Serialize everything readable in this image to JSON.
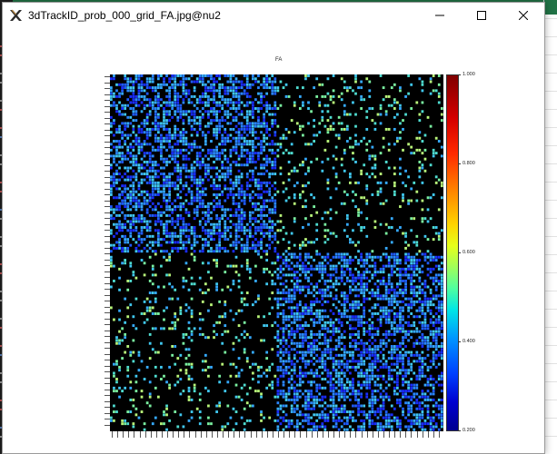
{
  "window": {
    "title": "3dTrackID_prob_000_grid_FA.jpg@nu2"
  },
  "figure": {
    "title": "FA",
    "colorbar_ticks": [
      "1.000",
      "0.800",
      "0.600",
      "0.400",
      "0.200"
    ]
  },
  "colors": {
    "matrix_background": "#000000",
    "window_background": "#ffffff",
    "colormap": "jet"
  },
  "icons": {
    "app": "afni-x-icon",
    "minimize": "minimize-icon",
    "maximize": "maximize-icon",
    "close": "close-icon"
  }
}
